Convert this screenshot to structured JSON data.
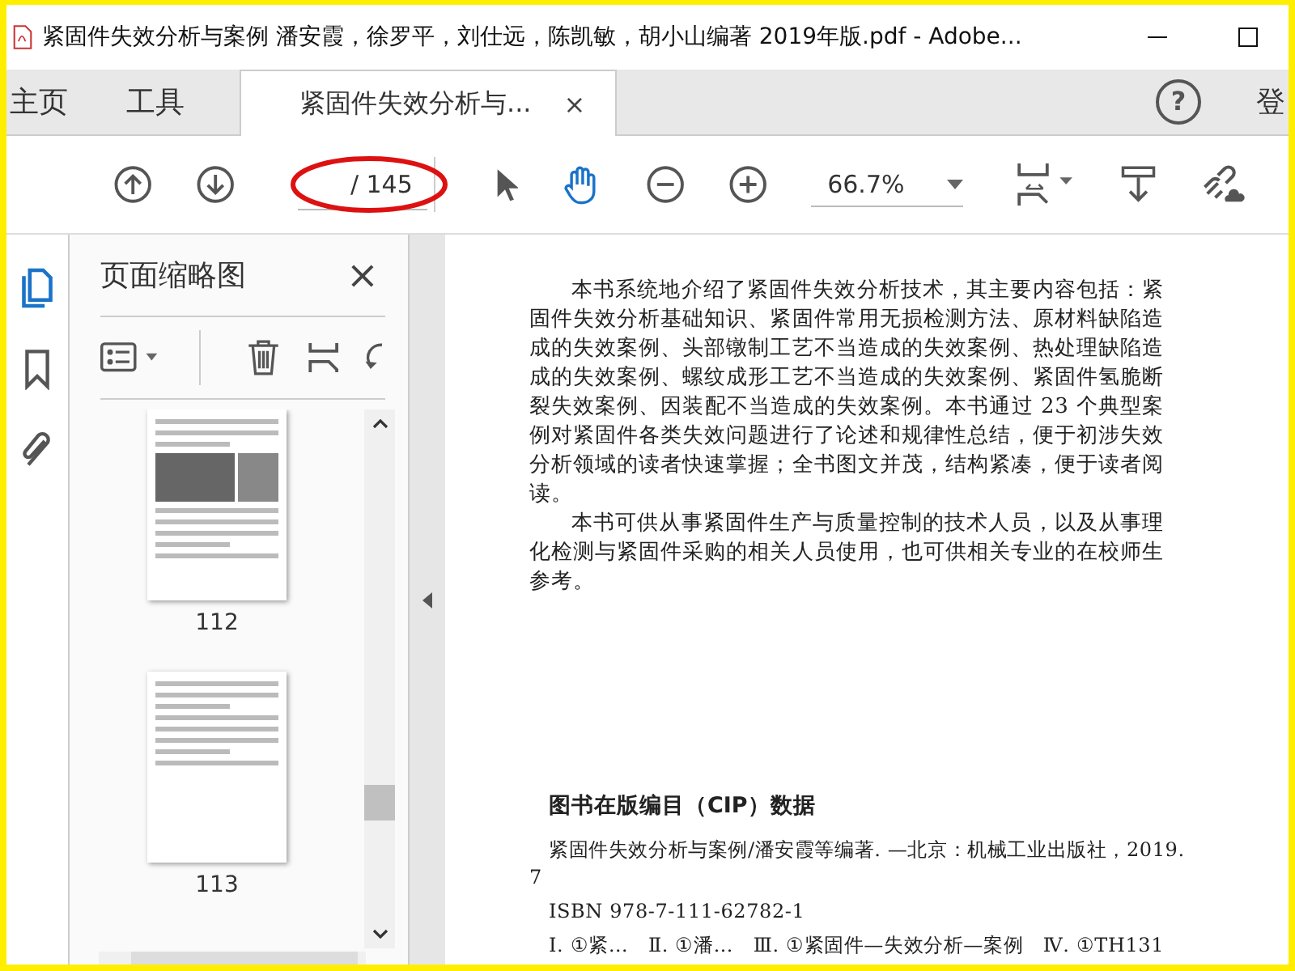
{
  "window": {
    "title": "紧固件失效分析与案例 潘安霞，徐罗平，刘仕远，陈凯敏，胡小山编著 2019年版.pdf - Adobe..."
  },
  "tabs": [
    {
      "label": "主页",
      "selected": false
    },
    {
      "label": "工具",
      "selected": false
    },
    {
      "label": "紧固件失效分析与...",
      "selected": true,
      "close": "×"
    }
  ],
  "help": "?",
  "account_label": "登",
  "toolbar": {
    "page_total": "/ 145",
    "zoom": "66.7%",
    "hand_tool_selected": true
  },
  "sidebar": {
    "title": "页面缩略图",
    "close": "×",
    "thumbnails": [
      {
        "label": "112"
      },
      {
        "label": "113"
      }
    ]
  },
  "document": {
    "paragraphs": [
      "本书系统地介绍了紧固件失效分析技术，其主要内容包括：紧固件失效分析基础知识、紧固件常用无损检测方法、原材料缺陷造成的失效案例、头部镦制工艺不当造成的失效案例、热处理缺陷造成的失效案例、螺纹成形工艺不当造成的失效案例、紧固件氢脆断裂失效案例、因装配不当造成的失效案例。本书通过 23 个典型案例对紧固件各类失效问题进行了论述和规律性总结，便于初涉失效分析领域的读者快速掌握；全书图文并茂，结构紧凑，便于读者阅读。",
      "本书可供从事紧固件生产与质量控制的技术人员，以及从事理化检测与紧固件采购的相关人员使用，也可供相关专业的在校师生参考。"
    ],
    "cip_heading": "图书在版编目（CIP）数据",
    "cip_lines": [
      "紧固件失效分析与案例/潘安霞等编著. —北京：机械工业出版社，2019. 7",
      "ISBN 978-7-111-62782-1",
      "Ⅰ. ①紧…　Ⅱ. ①潘…　Ⅲ. ①紧固件—失效分析—案例　Ⅳ. ①TH131"
    ]
  }
}
